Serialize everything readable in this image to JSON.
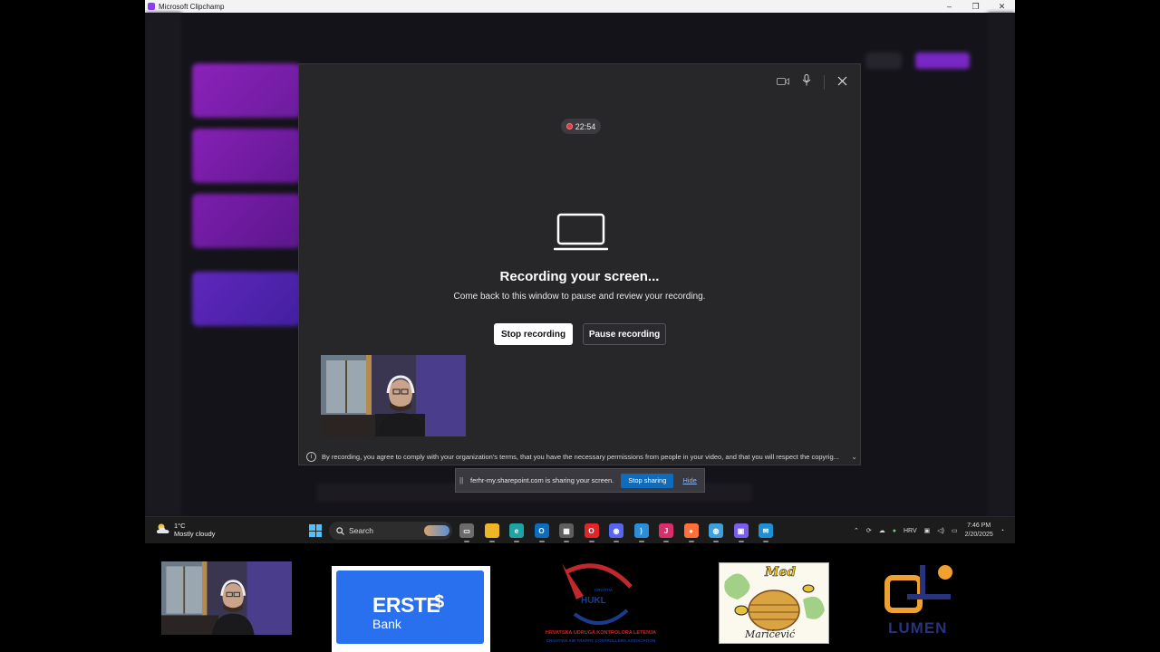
{
  "window": {
    "title": "Microsoft Clipchamp",
    "controls": {
      "minimize": "–",
      "restore": "❐",
      "close": "✕"
    }
  },
  "modal": {
    "timer": "22:54",
    "headline": "Recording your screen...",
    "subtext": "Come back to this window to pause and review your recording.",
    "stop_label": "Stop recording",
    "pause_label": "Pause recording",
    "disclaimer": "By recording, you agree to comply with your organization's terms, that you have the necessary permissions from people in your video, and that you will respect the copyrig...",
    "icons": [
      "camera-icon",
      "microphone-icon",
      "close-icon",
      "info-icon",
      "chevron-down-icon"
    ]
  },
  "sharebar": {
    "message": "ferhr-my.sharepoint.com is sharing your screen.",
    "stop_label": "Stop sharing",
    "hide_label": "Hide"
  },
  "taskbar": {
    "weather_temp": "1°C",
    "weather_desc": "Mostly cloudy",
    "search_label": "Search",
    "language": "HRV",
    "time": "7:46 PM",
    "date": "2/20/2025",
    "apps": [
      {
        "name": "task-view",
        "glyph": "▭",
        "color": "#6b6b6b"
      },
      {
        "name": "file-explorer",
        "glyph": "",
        "color": "#f0b429"
      },
      {
        "name": "edge",
        "glyph": "e",
        "color": "#1fa3a5"
      },
      {
        "name": "outlook",
        "glyph": "O",
        "color": "#0f6cbd"
      },
      {
        "name": "calculator",
        "glyph": "▦",
        "color": "#5e5e5e"
      },
      {
        "name": "opera",
        "glyph": "O",
        "color": "#e0262b"
      },
      {
        "name": "discord",
        "glyph": "◉",
        "color": "#5865f2"
      },
      {
        "name": "vscode",
        "glyph": "⟩",
        "color": "#2b8ed6"
      },
      {
        "name": "jetbrains",
        "glyph": "J",
        "color": "#d62f6b"
      },
      {
        "name": "firefox",
        "glyph": "●",
        "color": "#ff7139"
      },
      {
        "name": "globe",
        "glyph": "◍",
        "color": "#3f9fd8"
      },
      {
        "name": "clipchamp",
        "glyph": "▣",
        "color": "#7b5cf0"
      },
      {
        "name": "mail",
        "glyph": "✉",
        "color": "#1e90d6"
      }
    ]
  },
  "logos": {
    "erste_name": "ERSTE",
    "erste_bank": "Bank",
    "hukl_name": "HUKL",
    "hukl_croatia": "CROATIA",
    "hukl_line1": "HRVATSKA UDRUGA KONTROLORA LETENJA",
    "hukl_line2": "CROATIAN AIR TRAFFIC CONTROLLERS ASSOCIATION",
    "med_brand": "Med",
    "med_family": "Marićević",
    "lumen": "LUMEN"
  }
}
